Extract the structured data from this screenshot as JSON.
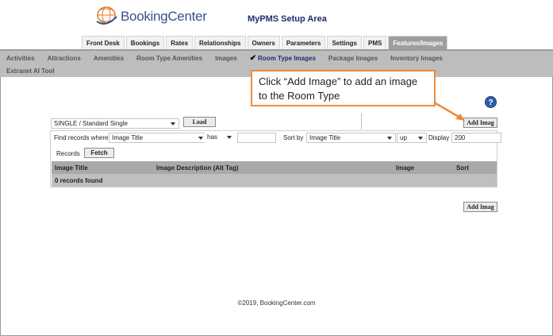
{
  "header": {
    "brand": "BookingCenter",
    "setup_title": "MyPMS Setup Area"
  },
  "tabs": [
    {
      "label": "Front Desk"
    },
    {
      "label": "Bookings"
    },
    {
      "label": "Rates"
    },
    {
      "label": "Relationships"
    },
    {
      "label": "Owners"
    },
    {
      "label": "Parameters"
    },
    {
      "label": "Settings"
    },
    {
      "label": "PMS"
    },
    {
      "label": "Features/Images",
      "active": true
    }
  ],
  "subnav": {
    "row1": [
      "Activities",
      "Attractions",
      "Amenities",
      "Room Type Amenities",
      "Images",
      "Room Type Images",
      "Package Images",
      "Inventory Images"
    ],
    "row2": [
      "Extranet AI Tool"
    ],
    "active": "Room Type Images"
  },
  "callout": {
    "text": "Click “Add Image” to add an image to the Room Type"
  },
  "icons": {
    "help": "help-icon",
    "check": "checkmark-icon",
    "logo": "globe-logo-icon"
  },
  "room_select": {
    "value": "SINGLE / Standard Single",
    "load_label": "Load"
  },
  "filter": {
    "find_label": "Find records where",
    "field_value": "Image Title",
    "op_value": "has",
    "search_value": "",
    "sort_label": "Sort by",
    "sort_value": "Image Title",
    "dir_value": "up",
    "display_label": "Display",
    "display_value": "200",
    "records_label": "Records",
    "fetch_label": "Fetch"
  },
  "table": {
    "columns": [
      "Image Title",
      "Image Description (Alt Tag)",
      "Image",
      "Sort"
    ],
    "empty_text": "0 records found"
  },
  "add_image_label": "Add Imag",
  "footer": "©2019, BookingCenter.com",
  "colors": {
    "accent": "#ef8a3a",
    "brand": "#3b4f8f",
    "subnav_bg": "#bdbdbd",
    "active_tab": "#9e9e9e"
  }
}
